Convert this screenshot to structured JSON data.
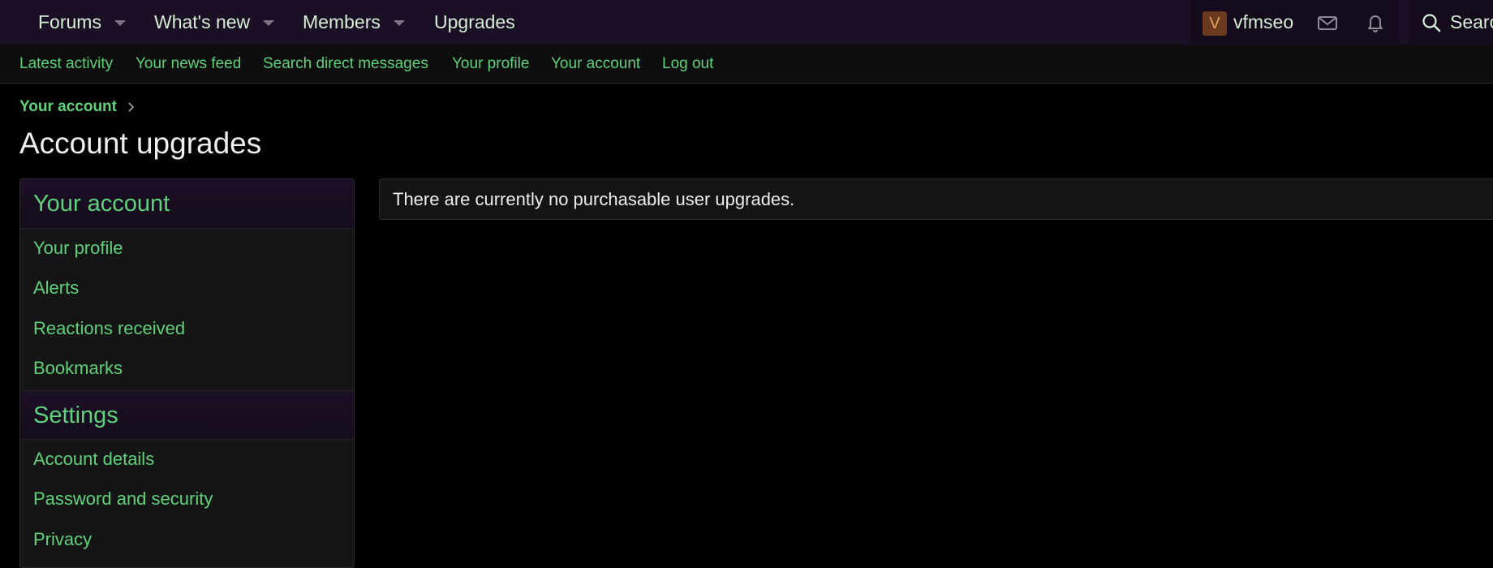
{
  "nav": {
    "tabs": [
      {
        "label": "Forums"
      },
      {
        "label": "What's new"
      },
      {
        "label": "Members"
      },
      {
        "label": "Upgrades"
      }
    ],
    "user": {
      "avatar_letter": "V",
      "name": "vfmseo"
    },
    "search_label": "Search",
    "icons": {
      "inbox": "envelope-icon",
      "alerts": "bell-icon",
      "search": "search-icon"
    }
  },
  "subnav": {
    "links": [
      "Latest activity",
      "Your news feed",
      "Search direct messages",
      "Your profile",
      "Your account",
      "Log out"
    ]
  },
  "breadcrumb": {
    "items": [
      "Your account"
    ]
  },
  "page_title": "Account upgrades",
  "sidemenu": {
    "sections": [
      {
        "header": "Your account",
        "items": [
          "Your profile",
          "Alerts",
          "Reactions received",
          "Bookmarks"
        ]
      },
      {
        "header": "Settings",
        "items": [
          "Account details",
          "Password and security",
          "Privacy"
        ]
      }
    ]
  },
  "main": {
    "notice": "There are currently no purchasable user upgrades."
  },
  "colors": {
    "link": "#5fd17a",
    "nav_bg": "#1a0f24",
    "page_bg": "#000000"
  }
}
